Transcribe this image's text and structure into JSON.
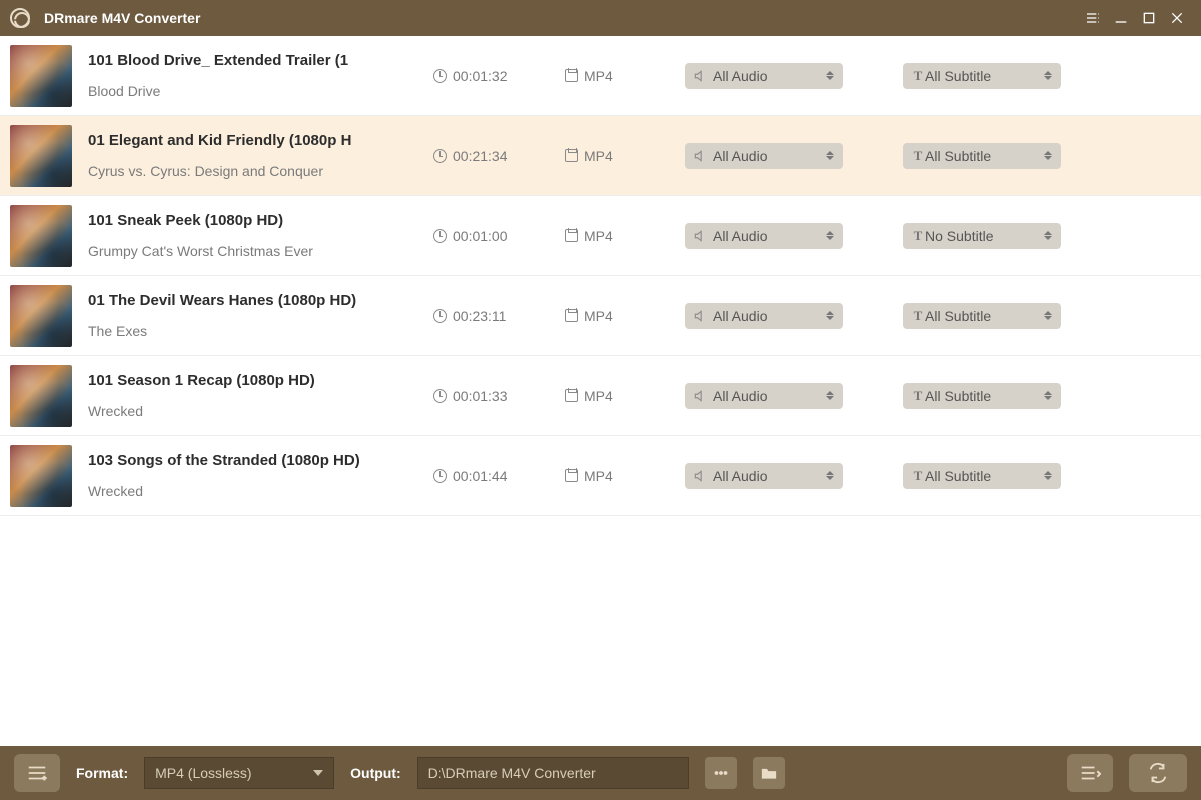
{
  "app": {
    "title": "DRmare M4V Converter"
  },
  "footer": {
    "format_label": "Format:",
    "format_value": "MP4 (Lossless)",
    "output_label": "Output:",
    "output_path": "D:\\DRmare M4V Converter"
  },
  "items": [
    {
      "title": "101 Blood Drive_ Extended Trailer (1",
      "sub": "Blood Drive",
      "duration": "00:01:32",
      "format": "MP4",
      "audio": "All Audio",
      "subtitle": "All Subtitle",
      "selected": false
    },
    {
      "title": "01 Elegant and Kid Friendly (1080p H",
      "sub": "Cyrus vs. Cyrus: Design and Conquer",
      "duration": "00:21:34",
      "format": "MP4",
      "audio": "All Audio",
      "subtitle": "All Subtitle",
      "selected": true
    },
    {
      "title": "101 Sneak Peek (1080p HD)",
      "sub": "Grumpy Cat's Worst Christmas Ever",
      "duration": "00:01:00",
      "format": "MP4",
      "audio": "All Audio",
      "subtitle": "No Subtitle",
      "selected": false
    },
    {
      "title": "01 The Devil Wears Hanes (1080p HD)",
      "sub": "The Exes",
      "duration": "00:23:11",
      "format": "MP4",
      "audio": "All Audio",
      "subtitle": "All Subtitle",
      "selected": false
    },
    {
      "title": "101 Season 1 Recap (1080p HD)",
      "sub": "Wrecked",
      "duration": "00:01:33",
      "format": "MP4",
      "audio": "All Audio",
      "subtitle": "All Subtitle",
      "selected": false
    },
    {
      "title": "103 Songs of the Stranded (1080p HD)",
      "sub": "Wrecked",
      "duration": "00:01:44",
      "format": "MP4",
      "audio": "All Audio",
      "subtitle": "All Subtitle",
      "selected": false
    }
  ]
}
